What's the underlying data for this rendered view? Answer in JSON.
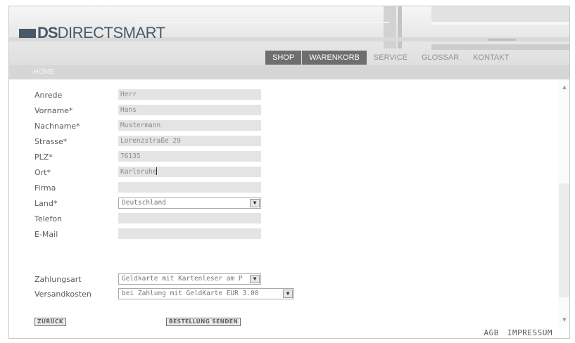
{
  "logo": {
    "ds": "DS",
    "rest": "DIRECTSMART"
  },
  "nav": [
    {
      "label": "SHOP",
      "active": true
    },
    {
      "label": "WARENKORB",
      "active": true
    },
    {
      "label": "SERVICE",
      "active": false
    },
    {
      "label": "GLOSSAR",
      "active": false
    },
    {
      "label": "KONTAKT",
      "active": false
    }
  ],
  "breadcrumb": "›HOME",
  "form": {
    "anrede": {
      "label": "Anrede",
      "value": "Herr"
    },
    "vorname": {
      "label": "Vorname*",
      "value": "Hans"
    },
    "nachname": {
      "label": "Nachname*",
      "value": "Mustermann"
    },
    "strasse": {
      "label": "Strasse*",
      "value": "Lorenzstraße 29"
    },
    "plz": {
      "label": "PLZ*",
      "value": "76135"
    },
    "ort": {
      "label": "Ort*",
      "value": "Karlsruhe"
    },
    "firma": {
      "label": "Firma",
      "value": ""
    },
    "land": {
      "label": "Land*",
      "value": "Deutschland"
    },
    "telefon": {
      "label": "Telefon",
      "value": ""
    },
    "email": {
      "label": "E-Mail",
      "value": ""
    },
    "zahlungsart": {
      "label": "Zahlungsart",
      "value": "Geldkarte mit Kartenleser am P"
    },
    "versandkosten": {
      "label": "Versandkosten",
      "value": "bei Zahlung mit GeldKarte EUR 3.00"
    }
  },
  "buttons": {
    "back": "ZURÜCK",
    "submit": "BESTELLUNG SENDEN"
  },
  "footer": {
    "agb": "AGB",
    "impressum": "IMPRESSUM"
  },
  "icons": {
    "dropdown": "chevron-down-icon",
    "scroll_up": "triangle-up-icon",
    "scroll_down": "triangle-down-icon"
  },
  "colors": {
    "nav_active": "#6e6e6e",
    "field_bg": "#e4e4e4",
    "logo": "#4a5968"
  }
}
